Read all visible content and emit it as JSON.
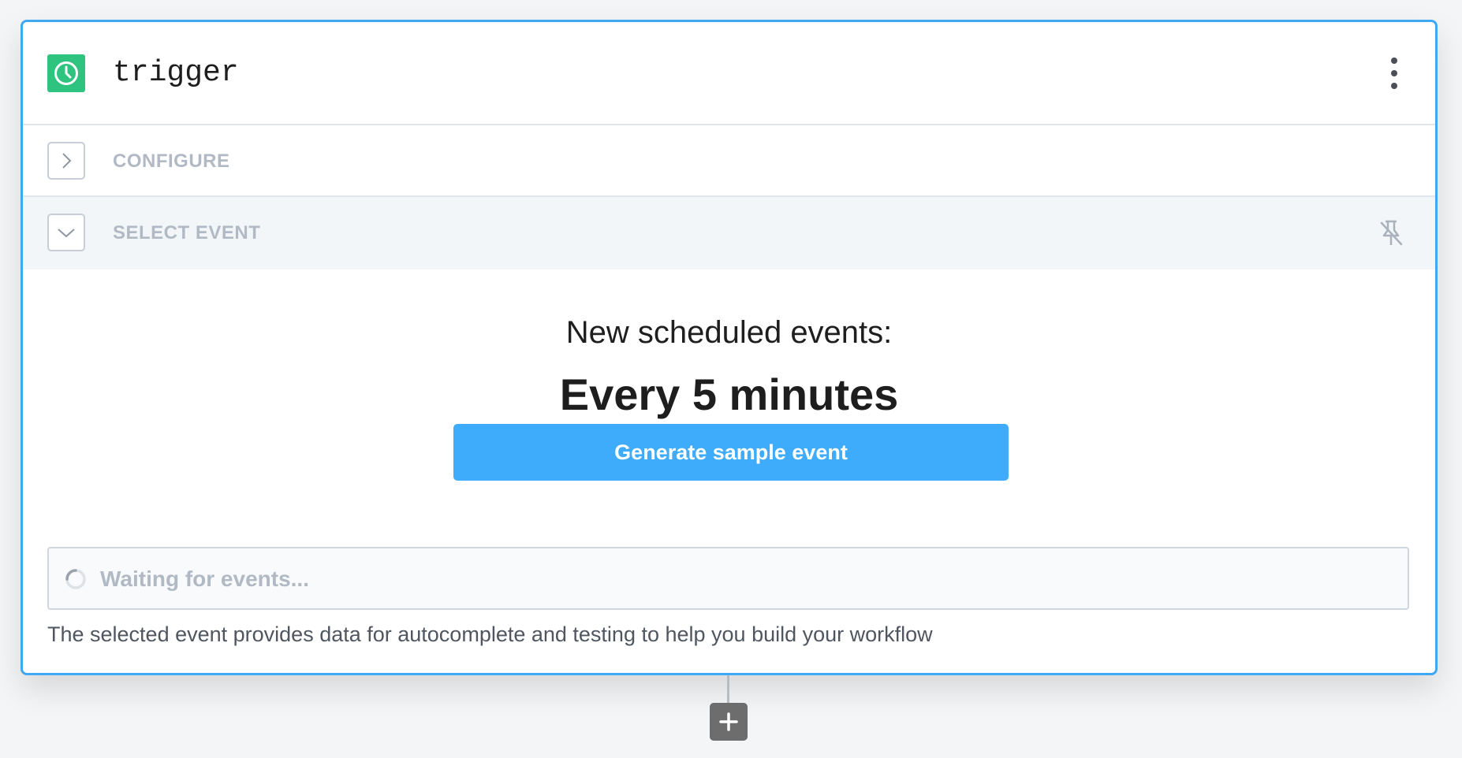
{
  "step": {
    "title": "trigger",
    "trigger_icon": "clock-icon",
    "menu_icon": "kebab-menu-icon"
  },
  "sections": {
    "configure": {
      "label": "CONFIGURE",
      "state": "collapsed",
      "icon": "chevron-right-icon"
    },
    "select_event": {
      "label": "SELECT EVENT",
      "state": "expanded",
      "icon": "chevron-down-icon",
      "pin_icon": "unpin-icon"
    }
  },
  "event": {
    "heading": "New scheduled events:",
    "interval": "Every 5 minutes",
    "generate_button": "Generate sample event",
    "waiting_text": "Waiting for events...",
    "helper_text": "The selected event provides data for autocomplete and testing to help you build your workflow"
  },
  "add_step": {
    "icon": "plus-icon"
  },
  "colors": {
    "accent_border": "#3fa8f4",
    "trigger_green": "#2fc380",
    "button_blue": "#3eacfb",
    "muted_label": "#b1bac4"
  }
}
